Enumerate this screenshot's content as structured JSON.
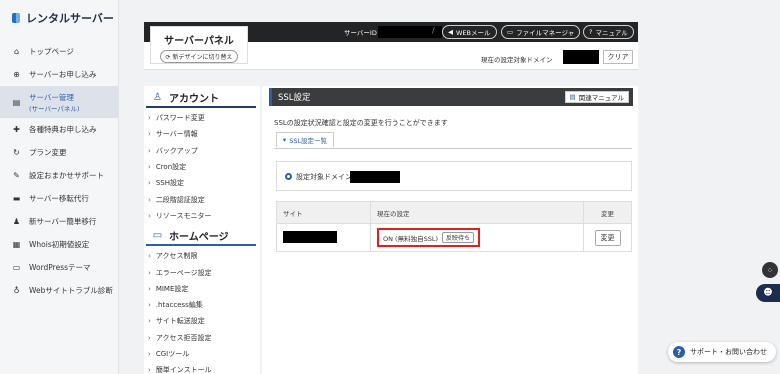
{
  "app": {
    "logo_text": "レンタルサーバー"
  },
  "global_nav": {
    "items": [
      {
        "icon": "home-icon",
        "label": "トップページ"
      },
      {
        "icon": "plus-circle-icon",
        "label": "サーバーお申し込み"
      },
      {
        "icon": "server-icon",
        "label": "サーバー管理",
        "sub": "(サーバーパネル)",
        "active": true
      },
      {
        "icon": "gift-icon",
        "label": "各種特典お申し込み"
      },
      {
        "icon": "refresh-icon",
        "label": "プラン変更"
      },
      {
        "icon": "wrench-icon",
        "label": "設定おまかせサポート"
      },
      {
        "icon": "truck-icon",
        "label": "サーバー移転代行"
      },
      {
        "icon": "person-icon",
        "label": "新サーバー簡単移行"
      },
      {
        "icon": "document-icon",
        "label": "Whois初期値設定"
      },
      {
        "icon": "window-icon",
        "label": "WordPressテーマ"
      },
      {
        "icon": "stethoscope-icon",
        "label": "Webサイトトラブル診断"
      }
    ]
  },
  "header": {
    "panel_title": "サーバーパネル",
    "switch_design": "新デザインに切り替え",
    "server_id_label": "サーバーID",
    "separator": "/",
    "buttons": {
      "webmail": "WEBメール",
      "file_manager": "ファイルマネージャ",
      "manual": "マニュアル"
    },
    "current_domain_label": "現在の設定対象ドメイン",
    "clear_label": "クリア"
  },
  "side": {
    "account": {
      "title": "アカウント",
      "items": [
        "パスワード変更",
        "サーバー情報",
        "バックアップ",
        "Cron設定",
        "SSH設定",
        "二段階認証設定",
        "リソースモニター"
      ]
    },
    "homepage": {
      "title": "ホームページ",
      "items": [
        "アクセス制限",
        "エラーページ設定",
        "MIME設定",
        ".htaccess編集",
        "サイト転送設定",
        "アクセス拒否設定",
        "CGIツール",
        "簡単インストール"
      ]
    },
    "chevron": "›"
  },
  "main": {
    "title": "SSL設定",
    "manual_label": "関連マニュアル",
    "description": "SSLの設定状況確認と設定の変更を行うことができます",
    "tab_label": "SSL設定一覧",
    "target_domain_label": "設定対象ドメイン",
    "table": {
      "headers": [
        "サイト",
        "現在の設定",
        "変更"
      ],
      "row": {
        "status": "ON (無料独自SSL)",
        "pill": "反映待ち",
        "change": "変更"
      }
    }
  },
  "support": {
    "label": "サポート・お問い合わせ"
  },
  "colors": {
    "accent": "#2a5db0",
    "header_bg": "#232426",
    "highlight": "#e02020"
  }
}
